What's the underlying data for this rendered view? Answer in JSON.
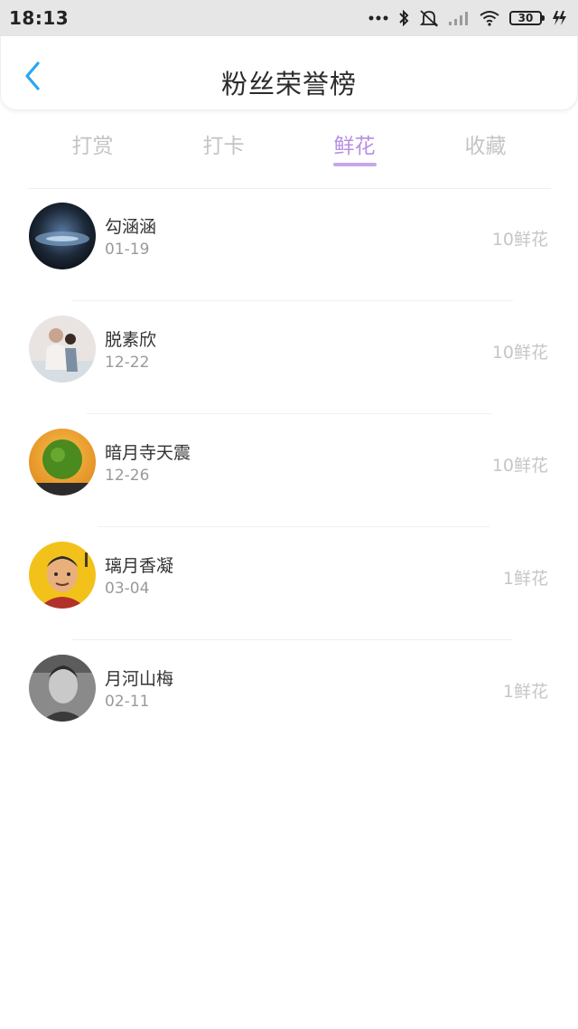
{
  "status_bar": {
    "time": "18:13",
    "icons": [
      "dots-icon",
      "bluetooth-icon",
      "mute-icon",
      "signal-icon",
      "wifi-icon",
      "battery-icon",
      "charging-icon"
    ],
    "battery_level": "30"
  },
  "header": {
    "title": "粉丝荣誉榜",
    "back_icon": "chevron-left-icon",
    "accent_color": "#2aa6f2"
  },
  "tabs": [
    {
      "label": "打赏",
      "active": false
    },
    {
      "label": "打卡",
      "active": false
    },
    {
      "label": "鲜花",
      "active": true
    },
    {
      "label": "收藏",
      "active": false
    }
  ],
  "active_tab_color": "#b98ee0",
  "fans": [
    {
      "name": "勾涵涵",
      "date": "01-19",
      "amount": "10鲜花"
    },
    {
      "name": "脱素欣",
      "date": "12-22",
      "amount": "10鲜花"
    },
    {
      "name": "暗月寺天震",
      "date": "12-26",
      "amount": "10鲜花"
    },
    {
      "name": "璃月香凝",
      "date": "03-04",
      "amount": "1鲜花"
    },
    {
      "name": "月河山梅",
      "date": "02-11",
      "amount": "1鲜花"
    }
  ]
}
